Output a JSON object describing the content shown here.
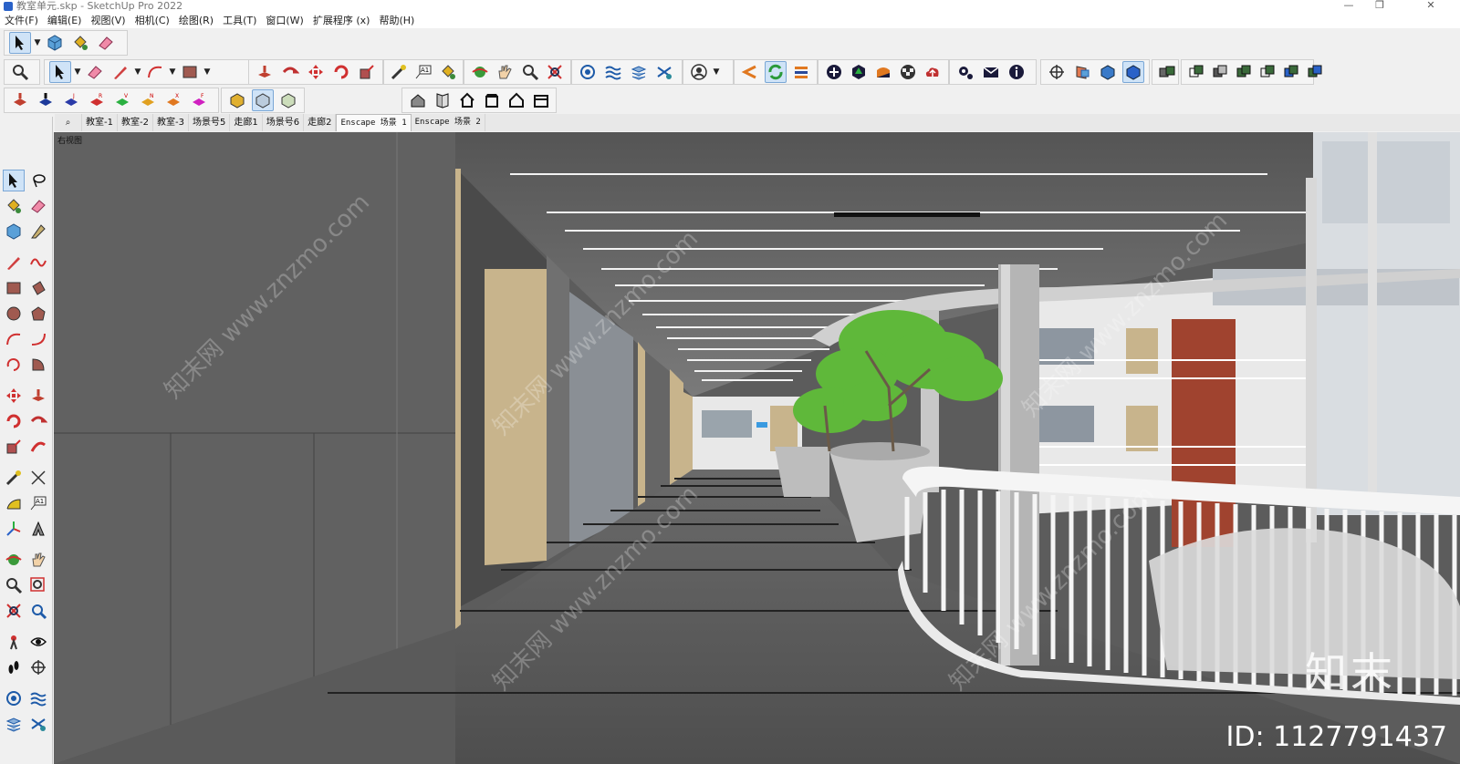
{
  "window": {
    "title": "教室单元.skp - SketchUp Pro 2022",
    "minimize": "—",
    "maximize": "❐",
    "close": "✕"
  },
  "menu": [
    "文件(F)",
    "编辑(E)",
    "视图(V)",
    "相机(C)",
    "绘图(R)",
    "工具(T)",
    "窗口(W)",
    "扩展程序 (x)",
    "帮助(H)"
  ],
  "scene_tabs": [
    {
      "label": "教室-1",
      "active": false
    },
    {
      "label": "教室-2",
      "active": false
    },
    {
      "label": "教室-3",
      "active": false
    },
    {
      "label": "场景号5",
      "active": false
    },
    {
      "label": "走廊1",
      "active": false
    },
    {
      "label": "场景号6",
      "active": false
    },
    {
      "label": "走廊2",
      "active": false
    },
    {
      "label": "Enscape 场景 1",
      "active": true
    },
    {
      "label": "Enscape 场景 2",
      "active": false
    }
  ],
  "viewport": {
    "view_label": "右视图",
    "watermark_logo": "知末",
    "watermark_id": "ID: 1127791437",
    "watermark_text": "知末网 www.znzmo.com"
  },
  "colors": {
    "accent": "#2a62c8",
    "active_tool": "#cfe3f7",
    "red_tool": "#e0342c",
    "floor": "#5e5e5e",
    "wood": "#c8b48c",
    "tree": "#5fb83a"
  }
}
